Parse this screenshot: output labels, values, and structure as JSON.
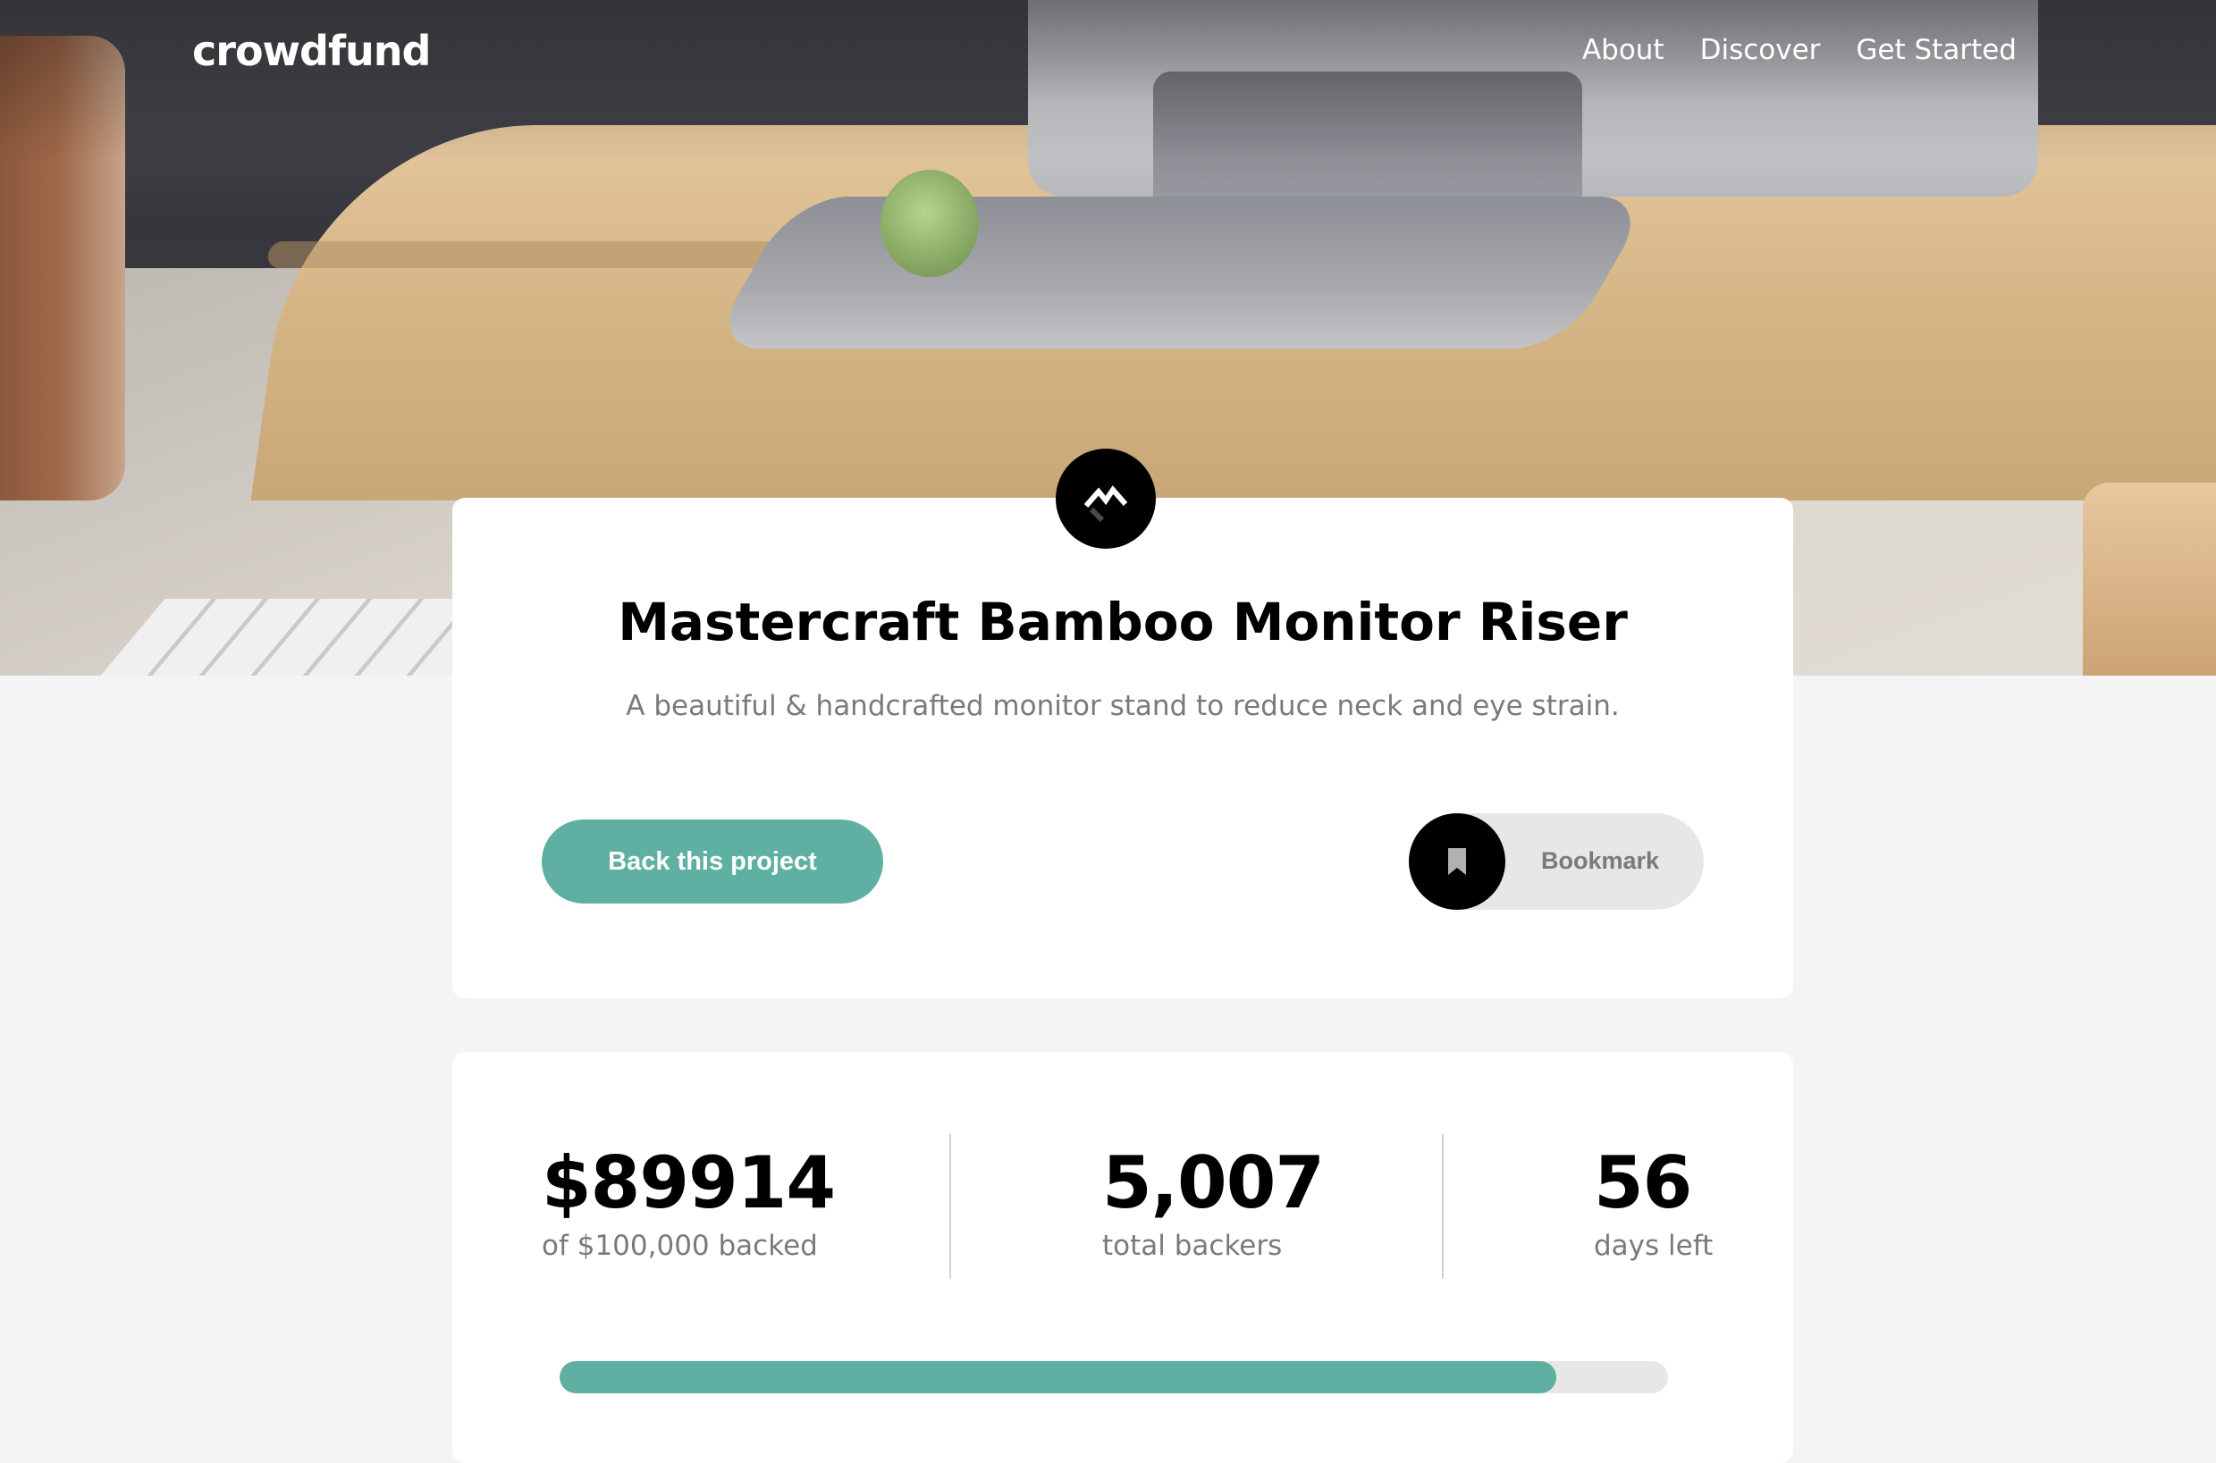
{
  "header": {
    "logo": "crowdfund",
    "nav": [
      "About",
      "Discover",
      "Get Started"
    ]
  },
  "project": {
    "logo_icon": "mastercraft-logo-icon",
    "title": "Mastercraft Bamboo Monitor Riser",
    "description": "A beautiful & handcrafted monitor stand to reduce neck and eye strain.",
    "back_button": "Back this project",
    "bookmark_button": "Bookmark",
    "bookmark_icon": "bookmark-icon"
  },
  "stats": {
    "backed_amount": "$89914",
    "backed_label": "of $100,000 backed",
    "backers": "5,007",
    "backers_label": "total backers",
    "days": "56",
    "days_label": "days left",
    "progress_fraction": 0.8991
  },
  "colors": {
    "accent": "#5fb0a3",
    "page_bg": "#f4f4f4"
  }
}
